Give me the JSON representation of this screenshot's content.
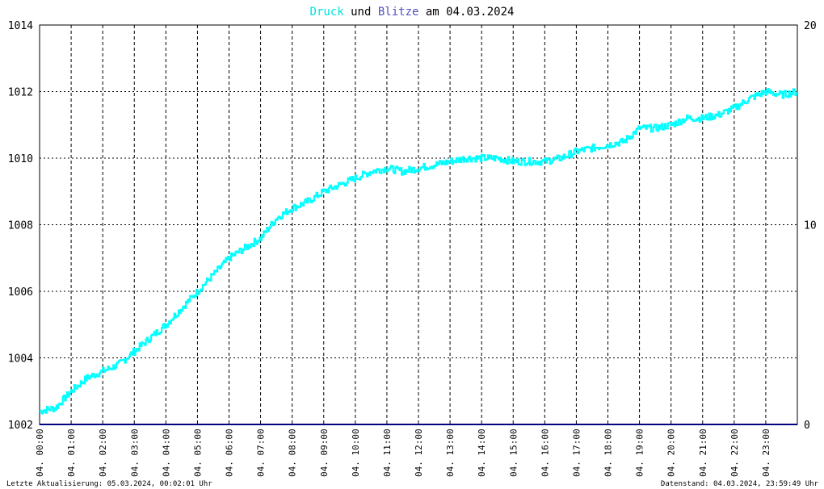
{
  "title": {
    "part1": "Druck",
    "part2": " und ",
    "part3": "Blitze",
    "part4": " am 04.03.2024",
    "color1": "#00e0e0",
    "color2": "#000000",
    "color3": "#5050c0",
    "color4": "#000000"
  },
  "footer": {
    "left": "Letzte Aktualisierung: 05.03.2024, 00:02:01 Uhr",
    "right": "Datenstand: 04.03.2024, 23:59:49 Uhr"
  },
  "chart_data": {
    "type": "line",
    "title": "Druck und Blitze am 04.03.2024",
    "ylim_left": [
      1002,
      1014
    ],
    "yticks_left": [
      1002,
      1004,
      1006,
      1008,
      1010,
      1012,
      1014
    ],
    "ylim_right": [
      0,
      20
    ],
    "yticks_right": [
      0,
      10,
      20
    ],
    "xlim_hours": [
      0,
      24
    ],
    "xtick_labels": [
      "04. 00:00",
      "04. 01:00",
      "04. 02:00",
      "04. 03:00",
      "04. 04:00",
      "04. 05:00",
      "04. 06:00",
      "04. 07:00",
      "04. 08:00",
      "04. 09:00",
      "04. 10:00",
      "04. 11:00",
      "04. 12:00",
      "04. 13:00",
      "04. 14:00",
      "04. 15:00",
      "04. 16:00",
      "04. 17:00",
      "04. 18:00",
      "04. 19:00",
      "04. 20:00",
      "04. 21:00",
      "04. 22:00",
      "04. 23:00"
    ],
    "grid": true,
    "series": [
      {
        "name": "Druck",
        "axis": "left",
        "color": "#00ffff",
        "x": [
          0,
          0.5,
          1,
          1.5,
          2,
          2.5,
          3,
          3.5,
          4,
          4.5,
          5,
          5.5,
          6,
          6.5,
          7,
          7.5,
          8,
          8.5,
          9,
          9.5,
          10,
          10.5,
          11,
          11.5,
          12,
          12.5,
          13,
          13.5,
          14,
          14.5,
          15,
          15.5,
          16,
          16.5,
          17,
          17.5,
          18,
          18.5,
          19,
          19.5,
          20,
          20.5,
          21,
          21.5,
          22,
          22.5,
          23,
          23.5,
          24
        ],
        "values": [
          1002.4,
          1002.5,
          1003.0,
          1003.4,
          1003.6,
          1003.8,
          1004.2,
          1004.6,
          1005.0,
          1005.5,
          1006.0,
          1006.5,
          1007.0,
          1007.3,
          1007.6,
          1008.2,
          1008.5,
          1008.7,
          1009.0,
          1009.2,
          1009.4,
          1009.6,
          1009.7,
          1009.6,
          1009.7,
          1009.8,
          1009.9,
          1010.0,
          1010.0,
          1010.0,
          1009.9,
          1009.9,
          1009.9,
          1010.0,
          1010.2,
          1010.3,
          1010.4,
          1010.5,
          1010.9,
          1010.9,
          1011.0,
          1011.2,
          1011.2,
          1011.3,
          1011.5,
          1011.8,
          1012.0,
          1011.9,
          1012.0
        ]
      },
      {
        "name": "Blitze",
        "axis": "right",
        "color": "#000080",
        "x": [
          0,
          24
        ],
        "values": [
          0,
          0
        ]
      }
    ]
  }
}
